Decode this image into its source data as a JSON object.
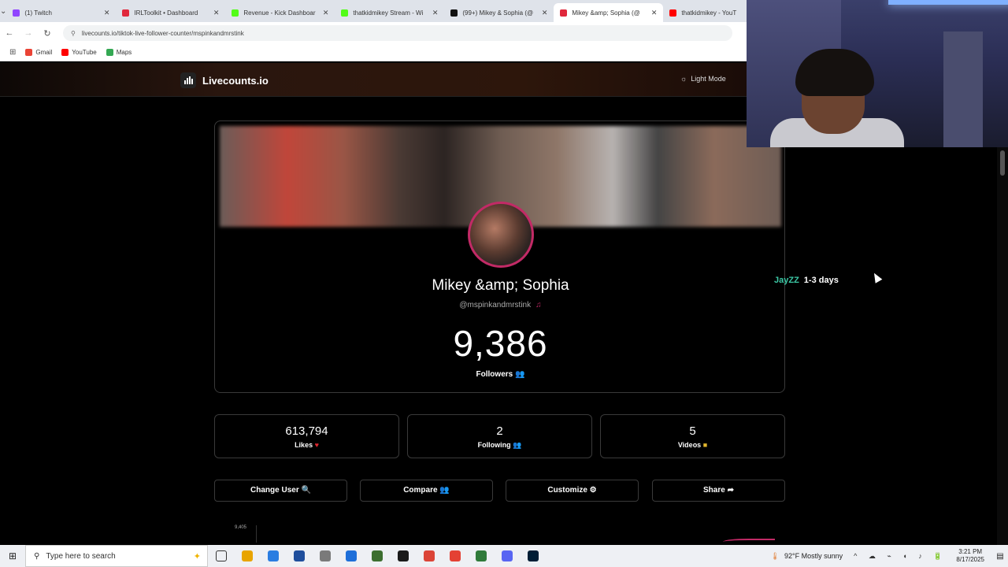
{
  "browser": {
    "tabs": [
      {
        "label": "(1) Twitch",
        "color": "#9146ff",
        "active": false
      },
      {
        "label": "IRLToolkit • Dashboard",
        "color": "#e0283c",
        "active": false
      },
      {
        "label": "Revenue - Kick Dashboar",
        "color": "#53fc18",
        "active": false
      },
      {
        "label": "thatkidmikey Stream - Wi",
        "color": "#53fc18",
        "active": false
      },
      {
        "label": "(99+) Mikey & Sophia (@",
        "color": "#111111",
        "active": false
      },
      {
        "label": "Mikey &amp; Sophia (@",
        "color": "#e0283c",
        "active": true
      },
      {
        "label": "thatkidmikey - YouT",
        "color": "#ff0000",
        "active": false
      }
    ],
    "url": "livecounts.io/tiktok-live-follower-counter/mspinkandmrstink",
    "bookmarks": [
      {
        "label": "Gmail",
        "color": "#ea4335"
      },
      {
        "label": "YouTube",
        "color": "#ff0000"
      },
      {
        "label": "Maps",
        "color": "#34a853"
      }
    ]
  },
  "site": {
    "brand": "Livecounts.io",
    "theme_toggle": "Light Mode"
  },
  "profile": {
    "display_name": "Mikey &amp; Sophia",
    "handle": "@mspinkandmrstink",
    "handle_icon": "♫",
    "followers": "9,386",
    "followers_label": "Followers"
  },
  "side_note": {
    "user": "JayZZ",
    "duration": "1-3 days"
  },
  "stats": {
    "likes": {
      "value": "613,794",
      "label": "Likes",
      "icon": "♥"
    },
    "following": {
      "value": "2",
      "label": "Following",
      "icon": "👥"
    },
    "videos": {
      "value": "5",
      "label": "Videos",
      "icon": "■"
    }
  },
  "actions": {
    "change_user": "Change User 🔍",
    "compare": "Compare 👥",
    "customize": "Customize ⚙",
    "share": "Share ➦"
  },
  "chart": {
    "tick_top": "9,405"
  },
  "taskbar": {
    "search_placeholder": "Type here to search",
    "weather": "92°F  Mostly sunny",
    "time": "3:21 PM",
    "date": "8/17/2025",
    "apps": [
      "#e8a400",
      "#2a7de1",
      "#1f4e9c",
      "#7a7a7a",
      "#1e6fd9",
      "#3c6e2f",
      "#1a1a1a",
      "#db4437",
      "#e44134",
      "#2f7a3a",
      "#5865f2",
      "#001e36"
    ]
  }
}
